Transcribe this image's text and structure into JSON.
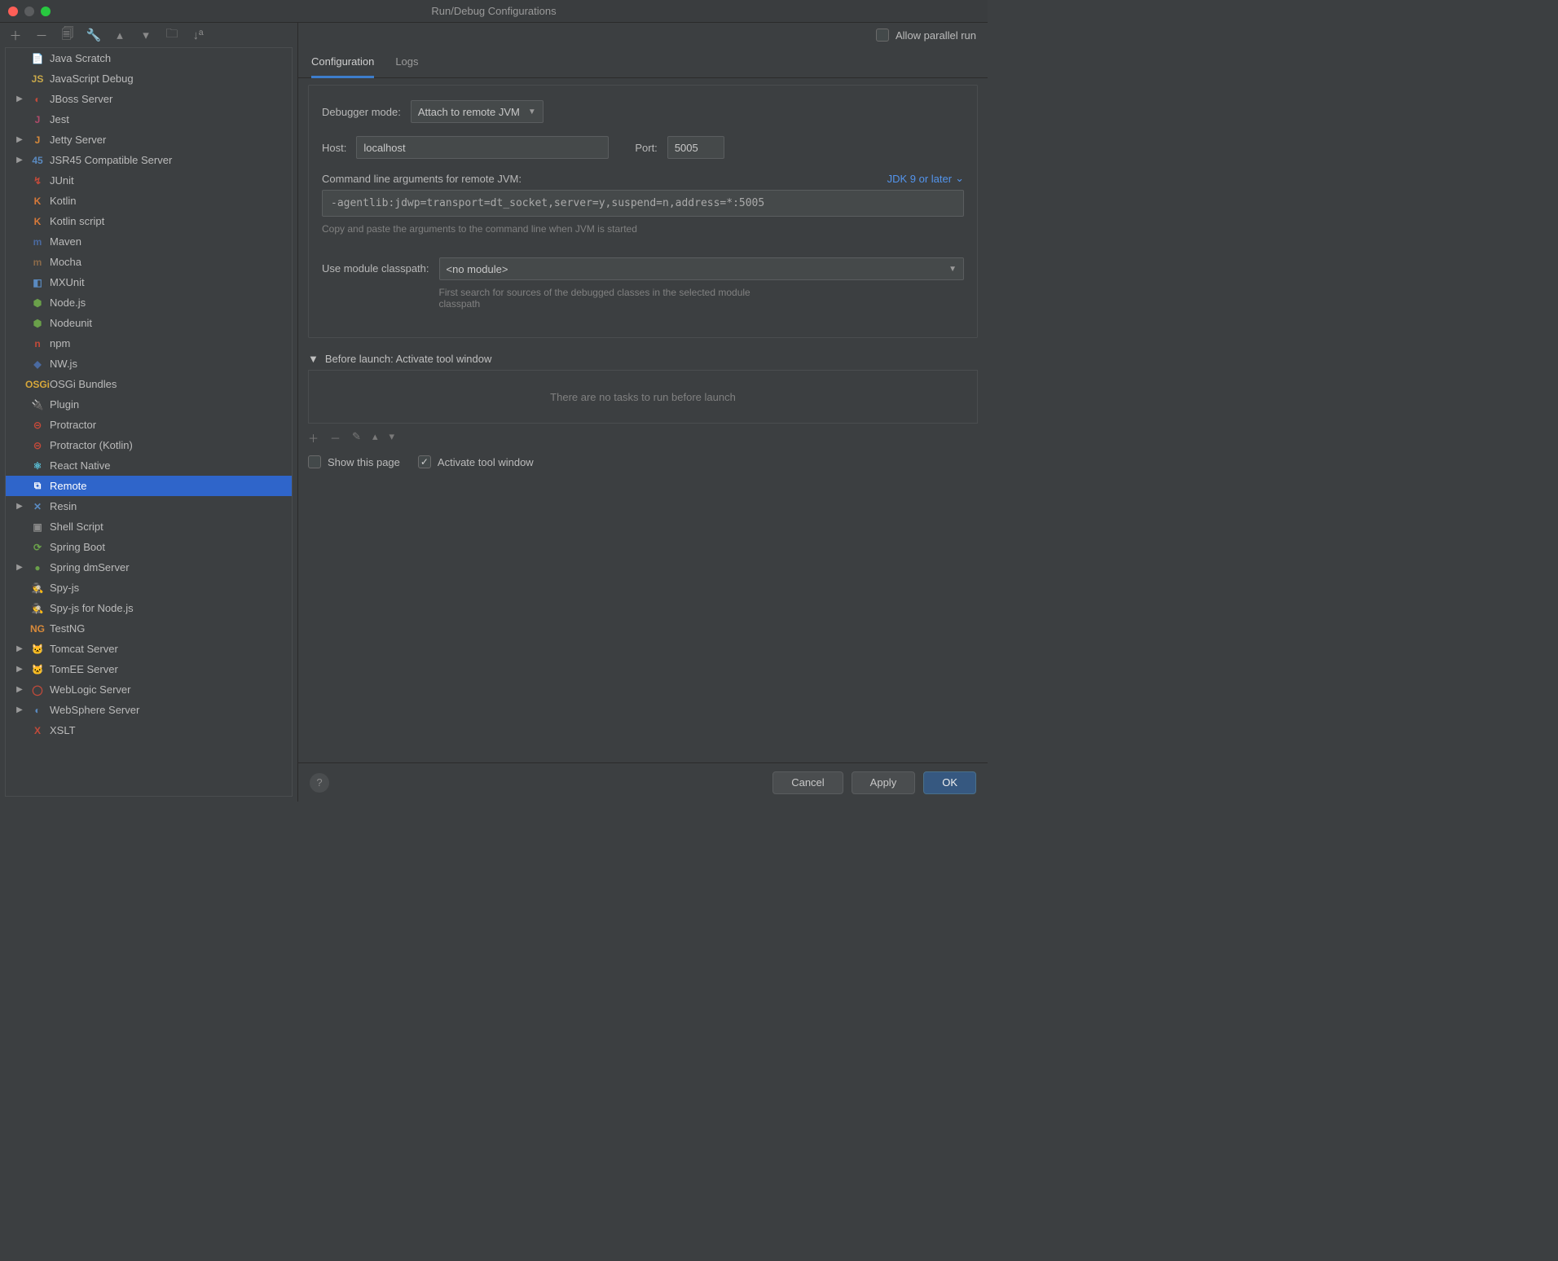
{
  "window": {
    "title": "Run/Debug Configurations"
  },
  "topRight": {
    "allowParallel": "Allow parallel run"
  },
  "treeItems": [
    {
      "label": "Java Scratch",
      "icon": "📄",
      "iconColor": "#6aa0d8",
      "expandable": false
    },
    {
      "label": "JavaScript Debug",
      "icon": "JS",
      "iconColor": "#c9a94a",
      "expandable": false
    },
    {
      "label": "JBoss Server",
      "icon": "◐",
      "iconColor": "#c24a3a",
      "expandable": true
    },
    {
      "label": "Jest",
      "icon": "J",
      "iconColor": "#b04a6a",
      "expandable": false
    },
    {
      "label": "Jetty Server",
      "icon": "J",
      "iconColor": "#d88a3a",
      "expandable": true
    },
    {
      "label": "JSR45 Compatible Server",
      "icon": "45",
      "iconColor": "#5a8ac0",
      "expandable": true
    },
    {
      "label": "JUnit",
      "icon": "↯",
      "iconColor": "#c24a3a",
      "expandable": false
    },
    {
      "label": "Kotlin",
      "icon": "K",
      "iconColor": "#d87a3a",
      "expandable": false
    },
    {
      "label": "Kotlin script",
      "icon": "K",
      "iconColor": "#d87a3a",
      "expandable": false
    },
    {
      "label": "Maven",
      "icon": "m",
      "iconColor": "#4a6aa0",
      "expandable": false
    },
    {
      "label": "Mocha",
      "icon": "m",
      "iconColor": "#8a6a4a",
      "expandable": false
    },
    {
      "label": "MXUnit",
      "icon": "◧",
      "iconColor": "#5a8ac0",
      "expandable": false
    },
    {
      "label": "Node.js",
      "icon": "⬢",
      "iconColor": "#6aa04a",
      "expandable": false
    },
    {
      "label": "Nodeunit",
      "icon": "⬢",
      "iconColor": "#6aa04a",
      "expandable": false
    },
    {
      "label": "npm",
      "icon": "n",
      "iconColor": "#c24a3a",
      "expandable": false
    },
    {
      "label": "NW.js",
      "icon": "◆",
      "iconColor": "#4a6aa0",
      "expandable": false
    },
    {
      "label": "OSGi Bundles",
      "icon": "OSGi",
      "iconColor": "#d8a83a",
      "expandable": false
    },
    {
      "label": "Plugin",
      "icon": "🔌",
      "iconColor": "#8a8a8a",
      "expandable": false
    },
    {
      "label": "Protractor",
      "icon": "⊝",
      "iconColor": "#c24a3a",
      "expandable": false
    },
    {
      "label": "Protractor (Kotlin)",
      "icon": "⊝",
      "iconColor": "#c24a3a",
      "expandable": false
    },
    {
      "label": "React Native",
      "icon": "⚛",
      "iconColor": "#5ac0d8",
      "expandable": false
    },
    {
      "label": "Remote",
      "icon": "⧉",
      "iconColor": "#ffffff",
      "expandable": false,
      "selected": true
    },
    {
      "label": "Resin",
      "icon": "✕",
      "iconColor": "#5a8ac0",
      "expandable": true
    },
    {
      "label": "Shell Script",
      "icon": "▣",
      "iconColor": "#8a8a8a",
      "expandable": false
    },
    {
      "label": "Spring Boot",
      "icon": "⟳",
      "iconColor": "#6aa04a",
      "expandable": false
    },
    {
      "label": "Spring dmServer",
      "icon": "●",
      "iconColor": "#6aa04a",
      "expandable": true
    },
    {
      "label": "Spy-js",
      "icon": "🕵",
      "iconColor": "#8a8a8a",
      "expandable": false
    },
    {
      "label": "Spy-js for Node.js",
      "icon": "🕵",
      "iconColor": "#8a8a8a",
      "expandable": false
    },
    {
      "label": "TestNG",
      "icon": "NG",
      "iconColor": "#d88a3a",
      "expandable": false
    },
    {
      "label": "Tomcat Server",
      "icon": "🐱",
      "iconColor": "#c0a050",
      "expandable": true
    },
    {
      "label": "TomEE Server",
      "icon": "🐱",
      "iconColor": "#c0a050",
      "expandable": true
    },
    {
      "label": "WebLogic Server",
      "icon": "◯",
      "iconColor": "#c24a3a",
      "expandable": true
    },
    {
      "label": "WebSphere Server",
      "icon": "◐",
      "iconColor": "#5a8ac0",
      "expandable": true
    },
    {
      "label": "XSLT",
      "icon": "X",
      "iconColor": "#c24a3a",
      "expandable": false
    }
  ],
  "tabs": {
    "configuration": "Configuration",
    "logs": "Logs"
  },
  "form": {
    "debuggerModeLabel": "Debugger mode:",
    "debuggerModeValue": "Attach to remote JVM",
    "hostLabel": "Host:",
    "hostValue": "localhost",
    "portLabel": "Port:",
    "portValue": "5005",
    "cmdLabel": "Command line arguments for remote JVM:",
    "jdkLink": "JDK 9 or later",
    "cmdValue": "-agentlib:jdwp=transport=dt_socket,server=y,suspend=n,address=*:5005",
    "cmdHint": "Copy and paste the arguments to the command line when JVM is started",
    "classpathLabel": "Use module classpath:",
    "classpathValue": "<no module>",
    "classpathHint": "First search for sources of the debugged classes in the selected module classpath"
  },
  "beforeLaunch": {
    "header": "Before launch: Activate tool window",
    "empty": "There are no tasks to run before launch",
    "showPage": "Show this page",
    "activateWindow": "Activate tool window"
  },
  "buttons": {
    "cancel": "Cancel",
    "apply": "Apply",
    "ok": "OK"
  }
}
